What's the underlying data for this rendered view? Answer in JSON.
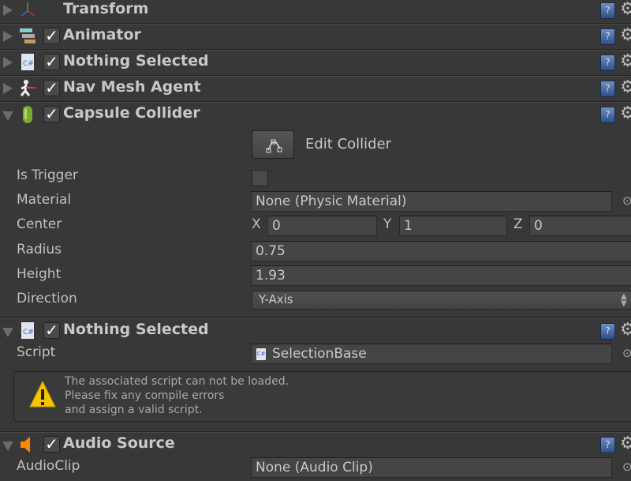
{
  "components": [
    {
      "title": "Transform",
      "icon": "transform-axes-icon",
      "expanded": false,
      "checkbox": false
    },
    {
      "title": "Animator",
      "icon": "animator-icon",
      "expanded": false,
      "checkbox": true
    },
    {
      "title": "Nothing Selected",
      "icon": "csharp-script-icon",
      "expanded": false,
      "checkbox": true
    },
    {
      "title": "Nav Mesh Agent",
      "icon": "nav-mesh-agent-icon",
      "expanded": false,
      "checkbox": true
    },
    {
      "title": "Capsule Collider",
      "icon": "capsule-collider-icon",
      "expanded": true,
      "checkbox": true
    },
    {
      "title": "Nothing Selected",
      "icon": "csharp-script-icon",
      "expanded": true,
      "checkbox": true
    },
    {
      "title": "Audio Source",
      "icon": "audio-source-icon",
      "expanded": true,
      "checkbox": true
    }
  ],
  "capsule": {
    "edit_collider": "Edit Collider",
    "is_trigger_label": "Is Trigger",
    "is_trigger": false,
    "material_label": "Material",
    "material": "None (Physic Material)",
    "center_label": "Center",
    "x_label": "X",
    "x": "0",
    "y_label": "Y",
    "y": "1",
    "z_label": "Z",
    "z": "0",
    "radius_label": "Radius",
    "radius": "0.75",
    "height_label": "Height",
    "height": "1.93",
    "direction_label": "Direction",
    "direction": "Y-Axis"
  },
  "script": {
    "script_label": "Script",
    "script": "SelectionBase",
    "warning": [
      "The associated script can not be loaded.",
      "Please fix any compile errors",
      "and assign a valid script."
    ]
  },
  "audio": {
    "clip_label": "AudioClip",
    "clip": "None (Audio Clip)"
  },
  "icons": {
    "help": "?",
    "gear": "⚙",
    "check": "✓",
    "picker": "⊙"
  }
}
